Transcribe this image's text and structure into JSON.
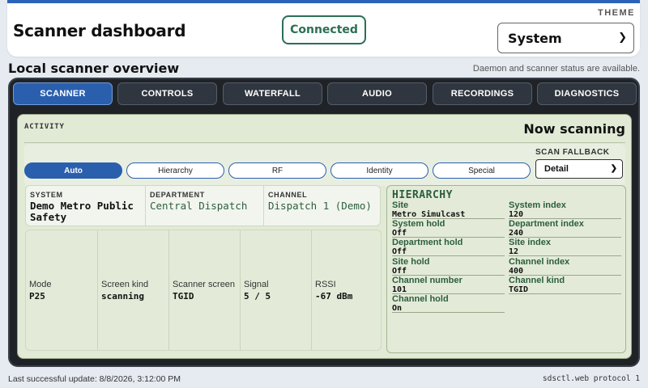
{
  "header": {
    "title": "Scanner dashboard",
    "connection_status": "Connected",
    "theme_label": "THEME",
    "theme_value": "System"
  },
  "section": {
    "title": "Local scanner overview",
    "note": "Daemon and scanner status are available."
  },
  "tabs": [
    {
      "label": "SCANNER",
      "active": true
    },
    {
      "label": "CONTROLS",
      "active": false
    },
    {
      "label": "WATERFALL",
      "active": false
    },
    {
      "label": "AUDIO",
      "active": false
    },
    {
      "label": "RECORDINGS",
      "active": false
    },
    {
      "label": "DIAGNOSTICS",
      "active": false
    }
  ],
  "activity": {
    "label": "ACTIVITY",
    "status": "Now scanning"
  },
  "modes": [
    {
      "label": "Auto",
      "active": true
    },
    {
      "label": "Hierarchy",
      "active": false
    },
    {
      "label": "RF",
      "active": false
    },
    {
      "label": "Identity",
      "active": false
    },
    {
      "label": "Special",
      "active": false
    }
  ],
  "scan_fallback": {
    "label": "SCAN FALLBACK",
    "value": "Detail"
  },
  "info": {
    "system": {
      "label": "SYSTEM",
      "value": "Demo Metro Public Safety"
    },
    "department": {
      "label": "DEPARTMENT",
      "value": "Central Dispatch"
    },
    "channel": {
      "label": "CHANNEL",
      "value": "Dispatch 1 (Demo)"
    }
  },
  "metrics": [
    {
      "label": "Mode",
      "value": "P25"
    },
    {
      "label": "Screen kind",
      "value": "scanning"
    },
    {
      "label": "Scanner screen",
      "value": "TGID"
    },
    {
      "label": "Signal",
      "value": "5 / 5"
    },
    {
      "label": "RSSI",
      "value": "-67 dBm"
    }
  ],
  "hierarchy": {
    "title": "HIERARCHY",
    "items": [
      {
        "label": "Site",
        "value": "Metro Simulcast"
      },
      {
        "label": "System index",
        "value": "120"
      },
      {
        "label": "System hold",
        "value": "Off"
      },
      {
        "label": "Department index",
        "value": "240"
      },
      {
        "label": "Department hold",
        "value": "Off"
      },
      {
        "label": "Site index",
        "value": "12"
      },
      {
        "label": "Site hold",
        "value": "Off"
      },
      {
        "label": "Channel index",
        "value": "400"
      },
      {
        "label": "Channel number",
        "value": "101"
      },
      {
        "label": "Channel kind",
        "value": "TGID"
      },
      {
        "label": "Channel hold",
        "value": "On"
      }
    ]
  },
  "footer": {
    "last_update": "Last successful update: 8/8/2026, 3:12:00 PM",
    "protocol": "sdsctl.web protocol 1"
  }
}
